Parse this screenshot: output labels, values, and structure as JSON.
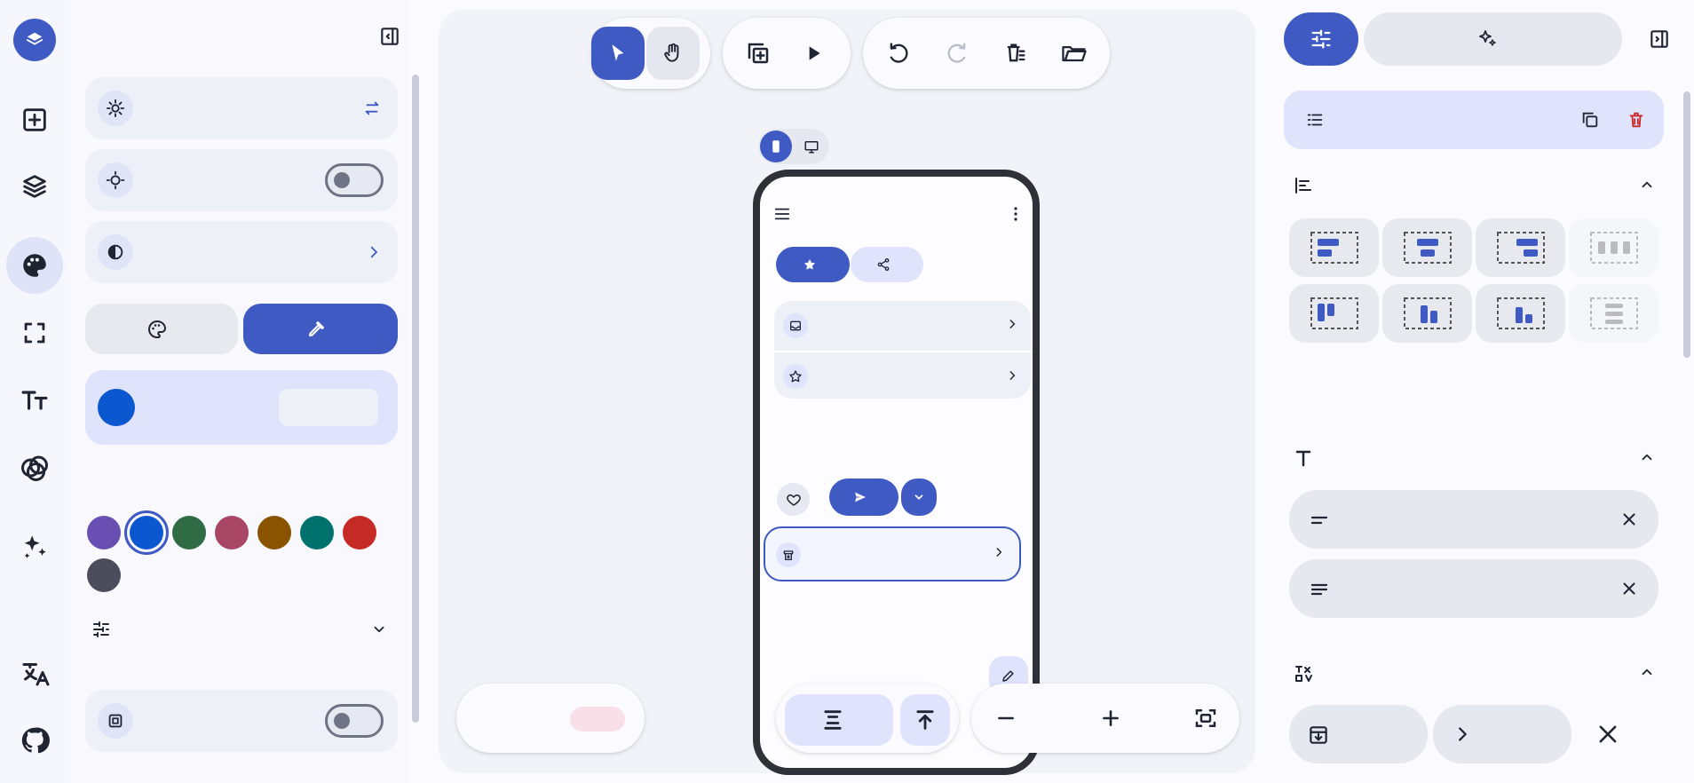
{
  "left_rail": {
    "items": [
      {
        "icon": "plus-square-icon"
      },
      {
        "icon": "layers-icon"
      },
      {
        "icon": "palette-icon",
        "active": true
      },
      {
        "icon": "selection-icon"
      },
      {
        "icon": "typography-icon"
      },
      {
        "icon": "circles-icon"
      },
      {
        "icon": "sparkles-icon"
      },
      {
        "icon": "translate-icon"
      },
      {
        "icon": "github-icon"
      }
    ]
  },
  "left_panel": {
    "title": "",
    "theme_mode": {
      "label": "",
      "value": ""
    },
    "dark_mode": {
      "label": "",
      "enabled": false
    },
    "contrast": {
      "label": "",
      "value": ""
    },
    "segments": {
      "palette": "",
      "custom": "",
      "selected": "custom"
    },
    "seed_color": {
      "label": "",
      "hex": "",
      "color": "#0B57D0"
    },
    "seed_help": "",
    "swatches": [
      {
        "color": "#6a4fb3"
      },
      {
        "color": "#0b57d0",
        "selected": true
      },
      {
        "color": "#2f6b44"
      },
      {
        "color": "#a94666"
      },
      {
        "color": "#8a5300"
      },
      {
        "color": "#00726d"
      },
      {
        "color": "#c52b24"
      },
      {
        "color": "#4b4d5c"
      }
    ],
    "fine_tune": {
      "label": ""
    },
    "dynamic_color": {
      "label": "",
      "enabled": false,
      "help": ""
    }
  },
  "canvas": {
    "screen_title": "",
    "zoom": "",
    "ai_button": {
      "label": "",
      "badge": ""
    },
    "organize_button": "",
    "phone": {
      "app_title": "",
      "chips": {
        "favorite": "",
        "share": ""
      },
      "list": [
        {
          "title": "",
          "subtitle": ""
        },
        {
          "title": "",
          "subtitle": ""
        }
      ],
      "send_button": "",
      "selected_item": {
        "title": "",
        "subtitle": ""
      }
    }
  },
  "right_panel": {
    "prompt_button": "",
    "component": {
      "label": ""
    },
    "align": {
      "title": "",
      "description": ""
    },
    "text": {
      "title": "",
      "items": [
        "",
        ""
      ]
    },
    "icon": {
      "title": "",
      "left_icon": "",
      "right_icon": ""
    }
  }
}
